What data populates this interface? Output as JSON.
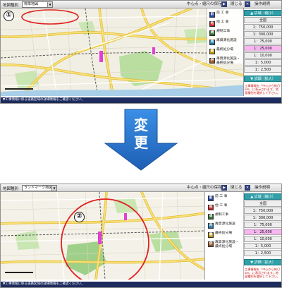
{
  "top": {
    "toolbar": {
      "map_type_label": "地図種別",
      "map_type_value": "標準地図",
      "center_scale_save": "中心点・縮尺の保存",
      "close": "閉じる",
      "help": "操作説明"
    },
    "annotation_number": "①",
    "scale_buttons": {
      "zoom_out": "▲ 広域（縮小）",
      "zoom_in": "▼ 詳細（拡大）"
    },
    "scale_rows": [
      "全国",
      "1：750,000",
      "1：300,000",
      "1：75,000",
      "1：25,000",
      "1：10,000",
      "1：5,000",
      "1：2,500"
    ],
    "active_scale_index": 4,
    "note": "工事情報を「中心から約〇km」に表示されます。地図種別を選択して下さい。",
    "footer": "▼工事情報に係る道路区域の詳細情報をご確認ください。"
  },
  "transition": {
    "line1": "変",
    "line2": "更"
  },
  "bottom": {
    "toolbar": {
      "map_type_label": "地図種別",
      "map_type_value": "ランドマーク地図",
      "center_scale_save": "中心点・縮尺の保存",
      "close": "閉じる",
      "help": "操作説明"
    },
    "annotation_number": "②",
    "legend": [
      {
        "text": "前 工 事",
        "color": "#2244aa",
        "sym": "前"
      },
      {
        "text": "他 工 事",
        "color": "#cc2222",
        "sym": "他"
      },
      {
        "text": "規制工事",
        "color": "#2b6b2b",
        "sym": "規"
      },
      {
        "text": "再資源化施設",
        "color": "#2277aa",
        "sym": "再"
      },
      {
        "text": "最終処分場",
        "color": "#bb9900",
        "sym": "最"
      },
      {
        "text": "再資源化施設・最終処分場",
        "color": "#995522",
        "sym": "併"
      }
    ],
    "scale_buttons": {
      "zoom_out": "▲ 広域（縮小）",
      "zoom_in": "▼ 詳細（拡大）"
    },
    "scale_rows": [
      "全国",
      "1：750,000",
      "1：300,000",
      "1：75,000",
      "1：25,000",
      "1：10,000",
      "1：5,000",
      "1：2,500"
    ],
    "active_scale_index": 4,
    "note": "工事情報を「中心から約〇km」に表示されます。地図種別を選択して下さい。",
    "footer": "▼工事情報に係る道路区域の詳細情報をご確認ください。"
  },
  "colors": {
    "toolbar_bg": "#dedede",
    "map_bg": "#f1efe3",
    "road_yellow": "#f3d24b",
    "road_white": "#ffffff",
    "green_area": "#b9dea0",
    "accent_teal": "#2f9fa8",
    "active_scale": "#f7b6f0",
    "arrow_blue": "#2e7bd6",
    "highlight_red": "#e02020",
    "footer_navy": "#1d2c5e"
  }
}
